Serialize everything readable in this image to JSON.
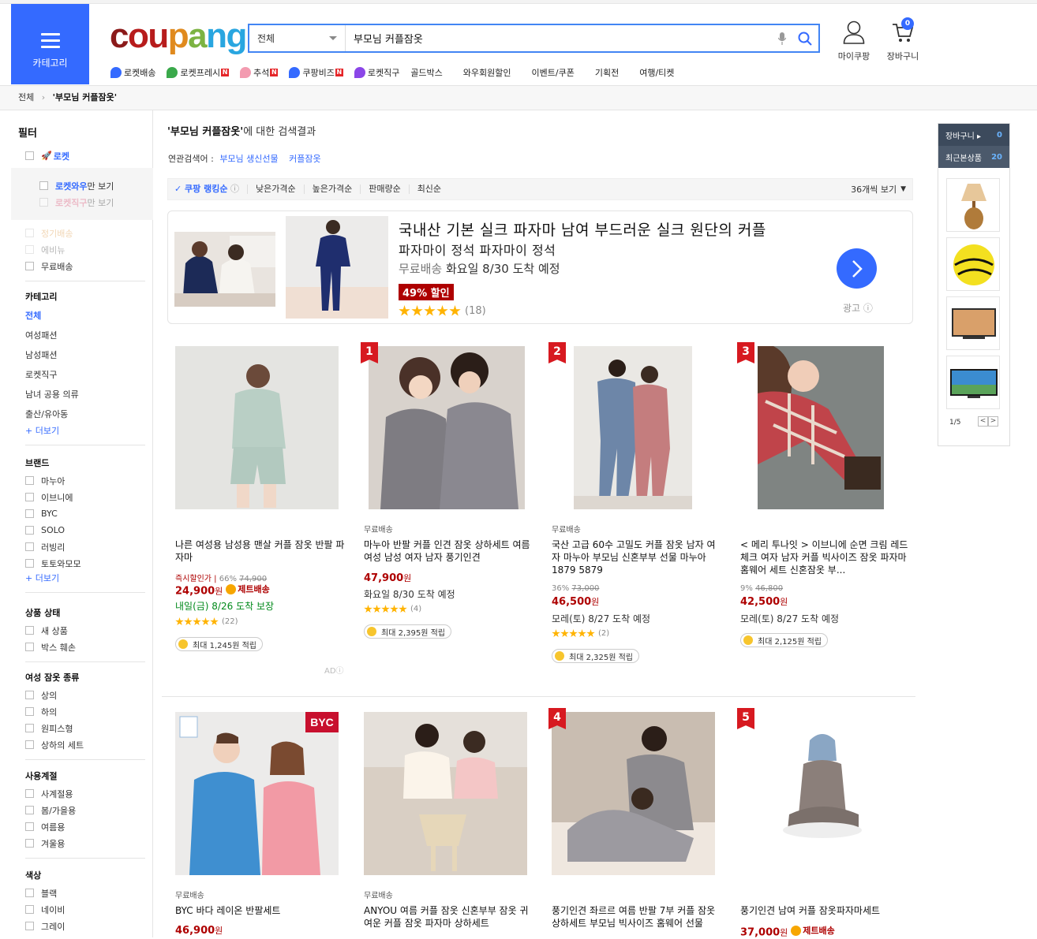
{
  "header": {
    "category_label": "카테고리",
    "search": {
      "scope": "전체",
      "query": "부모님 커플잠옷"
    },
    "mypage_label": "마이쿠팡",
    "cart_label": "장바구니",
    "cart_count": "0"
  },
  "menu": [
    {
      "label": "로켓배송",
      "icon": "rocket-icon",
      "badge": ""
    },
    {
      "label": "로켓프레시",
      "icon": "rocket-fresh-icon",
      "badge": "N"
    },
    {
      "label": "추석",
      "icon": "pig-icon",
      "badge": "N"
    },
    {
      "label": "쿠팡비즈",
      "icon": "biz-icon",
      "badge": "N"
    },
    {
      "label": "로켓직구",
      "icon": "globe-icon",
      "badge": ""
    },
    {
      "label": "골드박스",
      "icon": "",
      "badge": ""
    },
    {
      "label": "와우회원할인",
      "icon": "",
      "badge": ""
    },
    {
      "label": "이벤트/쿠폰",
      "icon": "",
      "badge": ""
    },
    {
      "label": "기획전",
      "icon": "",
      "badge": ""
    },
    {
      "label": "여행/티켓",
      "icon": "",
      "badge": ""
    }
  ],
  "breadcrumb": {
    "root": "전체",
    "sep": "›",
    "current": "'부모님 커플잠옷'"
  },
  "filters": {
    "title": "필터",
    "rocket": "로켓",
    "rocket_wow": "로켓와우",
    "rocket_wow_suffix": "만 보기",
    "rocket_global": "로켓직구",
    "rocket_global_suffix": "만 보기",
    "subscription": "정기배송",
    "ecobag": "에비뉴",
    "free_shipping": "무료배송",
    "category_title": "카테고리",
    "categories": [
      "전체",
      "여성패션",
      "남성패션",
      "로켓직구",
      "남녀 공용 의류",
      "출산/유아동"
    ],
    "more": "+ 더보기",
    "brand_title": "브랜드",
    "brands": [
      "마누아",
      "이브니에",
      "BYC",
      "SOLO",
      "러빙리",
      "토토와모모"
    ],
    "condition_title": "상품 상태",
    "conditions": [
      "새 상품",
      "박스 훼손"
    ],
    "type_title": "여성 잠옷 종류",
    "types": [
      "상의",
      "하의",
      "원피스형",
      "상하의 세트"
    ],
    "season_title": "사용계절",
    "seasons": [
      "사계절용",
      "봄/가을용",
      "여름용",
      "겨울용"
    ],
    "color_title": "색상",
    "colors": [
      "블랙",
      "네이비",
      "그레이"
    ]
  },
  "results": {
    "keyword": "'부모님 커플잠옷'",
    "suffix": "에 대한 검색결과",
    "related_label": "연관검색어 :",
    "related": [
      "부모님 생신선물",
      "커플잠옷"
    ]
  },
  "sort": {
    "options": [
      "쿠팡 랭킹순",
      "낮은가격순",
      "높은가격순",
      "판매량순",
      "최신순"
    ],
    "per_page": "36개씩 보기"
  },
  "ad_banner": {
    "title": "국내산 기본 실크 파자마 남여 부드러운 실크 원단의 커플",
    "subtitle": "파자마이 정석 파자마이 정석",
    "ship_free": "무료배송",
    "ship_date": " 화요일 8/30 도착 예정",
    "discount": "49% 할인",
    "reviews": "(18)",
    "ad_label": "광고"
  },
  "products": [
    {
      "rank": "",
      "shipping": "",
      "name": "나른 여성용 남성용 맨살 커플 잠옷 반팔 파자마",
      "orig_prefix": "즉시할인가 | ",
      "discount": "66%",
      "orig_price": "74,900",
      "price": "24,900",
      "unit": "원",
      "jet": "제트배송",
      "delivery": "내일(금) 8/26 도착 보장",
      "delivery_green": true,
      "reviews": "(22)",
      "cashback": "최대 1,245원 적립",
      "ad": "AD"
    },
    {
      "rank": "1",
      "shipping": "무료배송",
      "name": "마누아 반팔 커플 인견 잠옷 상하세트 여름 여성 남성 여자 남자 풍기인견",
      "orig_prefix": "",
      "discount": "",
      "orig_price": "",
      "price": "47,900",
      "unit": "원",
      "jet": "",
      "delivery": "화요일 8/30 도착 예정",
      "delivery_green": false,
      "reviews": "(4)",
      "cashback": "최대 2,395원 적립",
      "ad": ""
    },
    {
      "rank": "2",
      "shipping": "무료배송",
      "name": "국산 고급 60수 고밀도 커플 잠옷 남자 여자 마누아 부모님 신혼부부 선물 마누아 1879 5879",
      "orig_prefix": "",
      "discount": "36%",
      "orig_price": "73,000",
      "price": "46,500",
      "unit": "원",
      "jet": "",
      "delivery": "모레(토) 8/27 도착 예정",
      "delivery_green": false,
      "reviews": "(2)",
      "cashback": "최대 2,325원 적립",
      "ad": ""
    },
    {
      "rank": "3",
      "shipping": "",
      "name": "< 메리 투나잇 > 이브니에 순면 크림 레드 체크 여자 남자 커플 빅사이즈 잠옷 파자마 홈웨어 세트 신혼잠옷 부...",
      "orig_prefix": "",
      "discount": "9%",
      "orig_price": "46,800",
      "price": "42,500",
      "unit": "원",
      "jet": "",
      "delivery": "모레(토) 8/27 도착 예정",
      "delivery_green": false,
      "reviews": "",
      "cashback": "최대 2,125원 적립",
      "ad": ""
    },
    {
      "rank": "",
      "shipping": "무료배송",
      "name": "BYC 바다 레이온 반팔세트",
      "price": "46,900",
      "unit": "원",
      "jet": "",
      "brand_tag": "BYC"
    },
    {
      "rank": "",
      "shipping": "무료배송",
      "name": "ANYOU 여름 커플 잠옷 신혼부부 잠옷 귀여운 커플 잠옷 파자마 상하세트",
      "price": "",
      "unit": "",
      "jet": ""
    },
    {
      "rank": "4",
      "shipping": "",
      "name": "풍기인견 좌르르 여름 반팔 7부 커플 잠옷 상하세트 부모님 빅사이즈 홈웨어 선물",
      "price": "",
      "unit": "",
      "jet": ""
    },
    {
      "rank": "5",
      "shipping": "",
      "name": "풍기인견 남여 커플 잠옷파자마세트",
      "price": "37,000",
      "unit": "원",
      "jet": "제트배송"
    }
  ],
  "right_panel": {
    "cart_label": "장바구니 ▸",
    "cart_count": "0",
    "recent_label": "최근본상품",
    "recent_count": "20",
    "page": "1/5",
    "prev": "<",
    "next": ">"
  },
  "colors": {
    "accent": "#346aff",
    "price": "#ae0000",
    "green": "#00891a",
    "star": "#ffb300"
  }
}
